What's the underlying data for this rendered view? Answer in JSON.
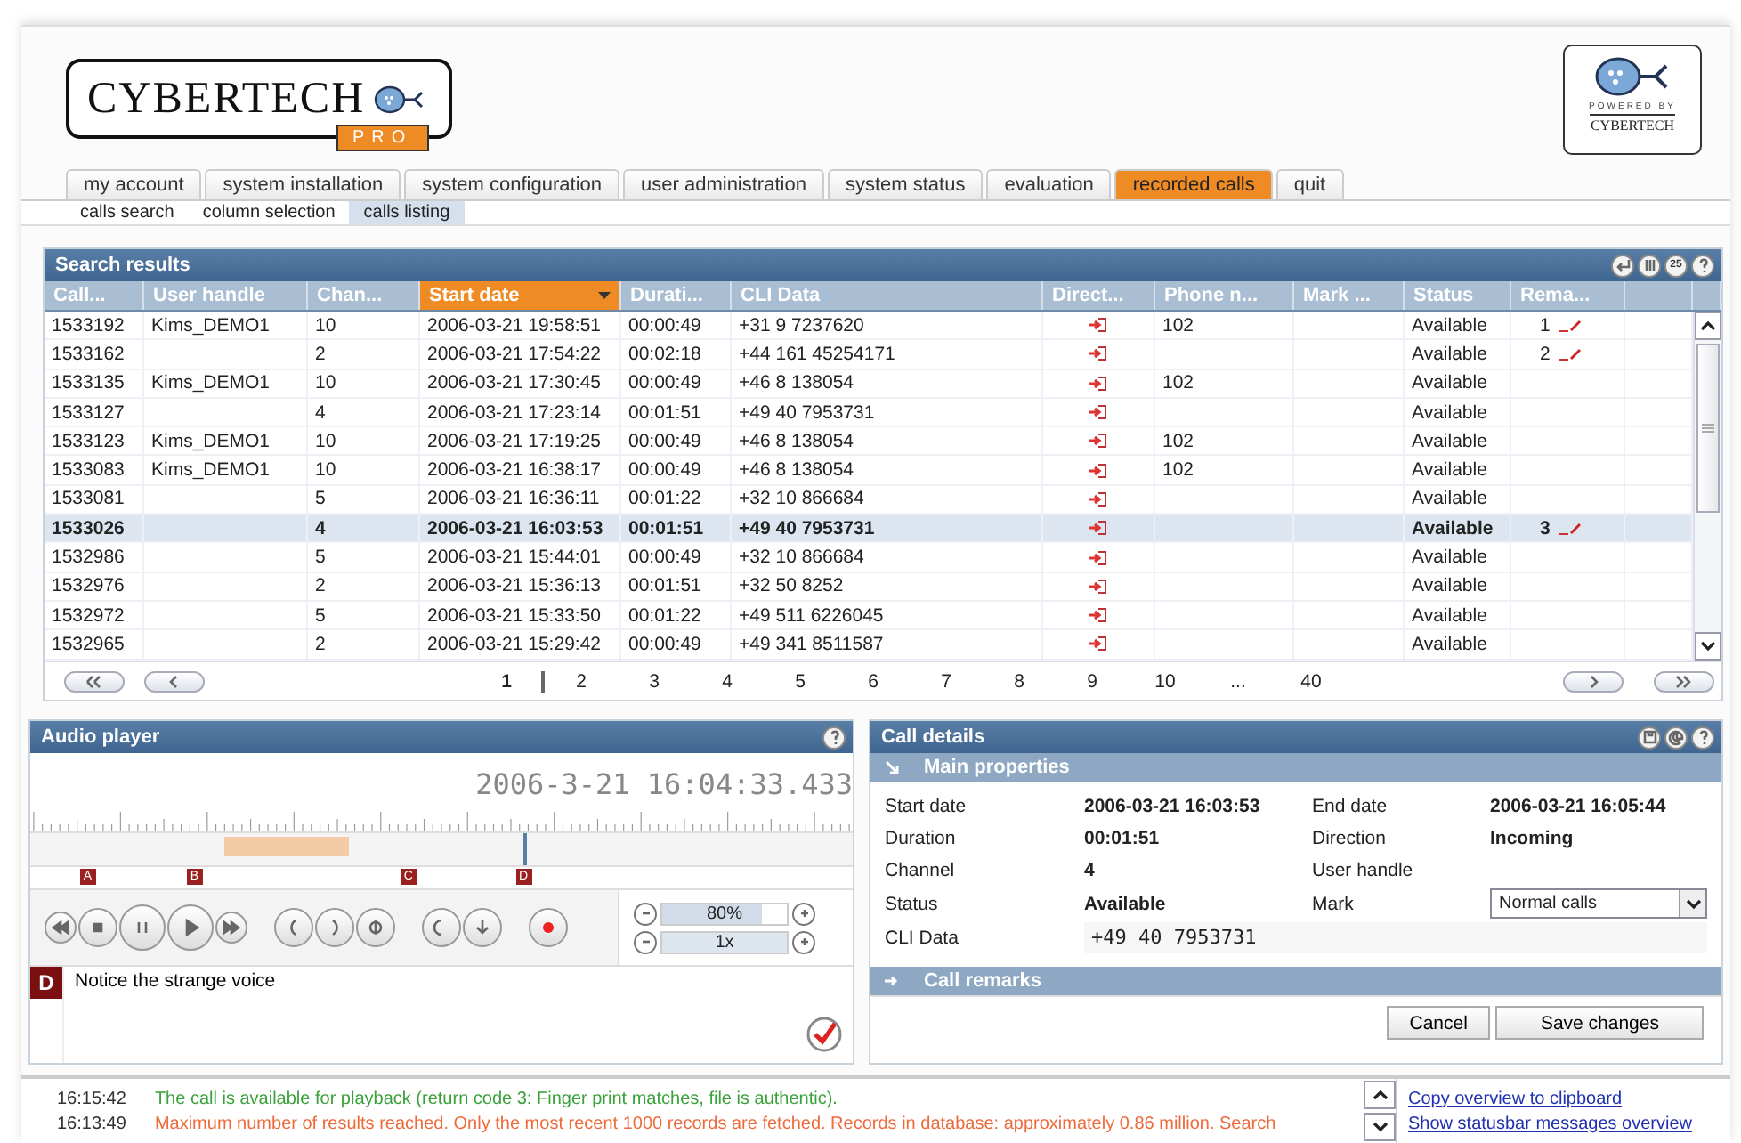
{
  "header": {
    "logo": {
      "name": "CYBERTECH",
      "badge": "PRO"
    },
    "powered_logo": {
      "caption": "POWERED BY",
      "name": "CYBERTECH"
    }
  },
  "tabs": [
    {
      "label": "my account",
      "selected": false
    },
    {
      "label": "system installation",
      "selected": false
    },
    {
      "label": "system configuration",
      "selected": false
    },
    {
      "label": "user administration",
      "selected": false
    },
    {
      "label": "system status",
      "selected": false
    },
    {
      "label": "evaluation",
      "selected": false
    },
    {
      "label": "recorded calls",
      "selected": true
    },
    {
      "label": "quit",
      "selected": false
    }
  ],
  "subtabs": [
    {
      "label": "calls search",
      "selected": false
    },
    {
      "label": "column selection",
      "selected": false
    },
    {
      "label": "calls listing",
      "selected": true
    }
  ],
  "search_results": {
    "title": "Search results",
    "page_size_icon": "25",
    "columns": [
      {
        "label": "Call...",
        "sorted": false
      },
      {
        "label": "User handle",
        "sorted": false
      },
      {
        "label": "Chan...",
        "sorted": false
      },
      {
        "label": "Start date",
        "sorted": true
      },
      {
        "label": "Durati...",
        "sorted": false
      },
      {
        "label": "CLI Data",
        "sorted": false
      },
      {
        "label": "Direct...",
        "sorted": false
      },
      {
        "label": "Phone n...",
        "sorted": false
      },
      {
        "label": "Mark ...",
        "sorted": false
      },
      {
        "label": "Status",
        "sorted": false
      },
      {
        "label": "Rema...",
        "sorted": false
      }
    ],
    "rows": [
      {
        "call": "1533192",
        "user": "Kims_DEMO1",
        "channel": "10",
        "start": "2006-03-21 19:58:51",
        "duration": "00:00:49",
        "cli": "+31 9 7237620",
        "phone": "102",
        "status": "Available",
        "remarks": "1",
        "selected": false
      },
      {
        "call": "1533162",
        "channel": "2",
        "start": "2006-03-21 17:54:22",
        "duration": "00:02:18",
        "cli": "+44 161 45254171",
        "status": "Available",
        "remarks": "2",
        "selected": false
      },
      {
        "call": "1533135",
        "user": "Kims_DEMO1",
        "channel": "10",
        "start": "2006-03-21 17:30:45",
        "duration": "00:00:49",
        "cli": "+46 8 138054",
        "phone": "102",
        "status": "Available",
        "selected": false
      },
      {
        "call": "1533127",
        "channel": "4",
        "start": "2006-03-21 17:23:14",
        "duration": "00:01:51",
        "cli": "+49 40 7953731",
        "status": "Available",
        "selected": false
      },
      {
        "call": "1533123",
        "user": "Kims_DEMO1",
        "channel": "10",
        "start": "2006-03-21 17:19:25",
        "duration": "00:00:49",
        "cli": "+46 8 138054",
        "phone": "102",
        "status": "Available",
        "selected": false
      },
      {
        "call": "1533083",
        "user": "Kims_DEMO1",
        "channel": "10",
        "start": "2006-03-21 16:38:17",
        "duration": "00:00:49",
        "cli": "+46 8 138054",
        "phone": "102",
        "status": "Available",
        "selected": false
      },
      {
        "call": "1533081",
        "channel": "5",
        "start": "2006-03-21 16:36:11",
        "duration": "00:01:22",
        "cli": "+32 10 866684",
        "status": "Available",
        "selected": false
      },
      {
        "call": "1533026",
        "channel": "4",
        "start": "2006-03-21 16:03:53",
        "duration": "00:01:51",
        "cli": "+49 40 7953731",
        "status": "Available",
        "remarks": "3",
        "selected": true
      },
      {
        "call": "1532986",
        "channel": "5",
        "start": "2006-03-21 15:44:01",
        "duration": "00:00:49",
        "cli": "+32 10 866684",
        "status": "Available",
        "selected": false
      },
      {
        "call": "1532976",
        "channel": "2",
        "start": "2006-03-21 15:36:13",
        "duration": "00:01:51",
        "cli": "+32 50 8252",
        "status": "Available",
        "selected": false
      },
      {
        "call": "1532972",
        "channel": "5",
        "start": "2006-03-21 15:33:50",
        "duration": "00:01:22",
        "cli": "+49 511 6226045",
        "status": "Available",
        "selected": false
      },
      {
        "call": "1532965",
        "channel": "2",
        "start": "2006-03-21 15:29:42",
        "duration": "00:00:49",
        "cli": "+49 341 8511587",
        "status": "Available",
        "selected": false
      }
    ],
    "pages": [
      {
        "label": "1",
        "selected": true
      },
      {
        "label": "2",
        "selected": false
      },
      {
        "label": "3",
        "selected": false
      },
      {
        "label": "4",
        "selected": false
      },
      {
        "label": "5",
        "selected": false
      },
      {
        "label": "6",
        "selected": false
      },
      {
        "label": "7",
        "selected": false
      },
      {
        "label": "8",
        "selected": false
      },
      {
        "label": "9",
        "selected": false
      },
      {
        "label": "10",
        "selected": false
      },
      {
        "label": "...",
        "selected": false
      },
      {
        "label": "40",
        "selected": false
      }
    ]
  },
  "audio_player": {
    "title": "Audio player",
    "timestamp": "2006-3-21 16:04:33.433",
    "playhead": {
      "level": 0.6
    },
    "markers": [
      "A",
      "B",
      "C",
      "D"
    ],
    "volume": {
      "reading": "80%",
      "level": 0.8
    },
    "speed": {
      "reading": "1x"
    },
    "note": {
      "marker": "D",
      "value": "Notice the strange voice"
    }
  },
  "call_details": {
    "title": "Call details",
    "main_properties": {
      "title": "Main properties",
      "expanded": true,
      "fields": [
        {
          "label": "Start date",
          "value": "2006-03-21 16:03:53",
          "kind": "text"
        },
        {
          "label": "End date",
          "value": "2006-03-21 16:05:44",
          "kind": "text"
        },
        {
          "label": "Duration",
          "value": "00:01:51",
          "kind": "text"
        },
        {
          "label": "Direction",
          "value": "Incoming",
          "kind": "text"
        },
        {
          "label": "Channel",
          "value": "4",
          "kind": "text"
        },
        {
          "label": "User handle",
          "kind": "text"
        },
        {
          "label": "Status",
          "value": "Available",
          "kind": "text"
        },
        {
          "label": "Mark",
          "value": "Normal calls",
          "kind": "select"
        },
        {
          "label": "CLI Data",
          "value": "+49 40 7953731",
          "kind": "mono"
        }
      ]
    },
    "call_remarks": {
      "title": "Call remarks",
      "expanded": false
    },
    "buttons": [
      "Cancel",
      "Save changes"
    ]
  },
  "status_bar": {
    "messages": [
      {
        "time": "16:15:42",
        "text": "The call is available for playback (return code 3: Finger print matches, file is authentic).",
        "kind": "success"
      },
      {
        "time": "16:13:49",
        "text": "Maximum number of results reached. Only the most recent 1000 records are fetched. Records in database: approximately 0.86 million. Search",
        "kind": "warning"
      }
    ],
    "links": [
      "Copy overview to clipboard",
      "Show statusbar messages overview"
    ]
  }
}
